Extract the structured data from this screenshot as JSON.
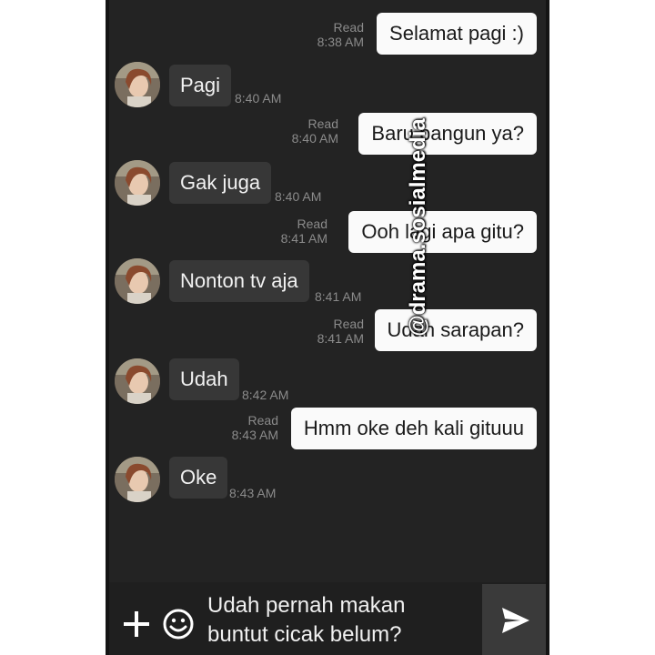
{
  "messages": [
    {
      "dir": "out",
      "text": "Selamat pagi :)",
      "status": "Read",
      "time": "8:38 AM"
    },
    {
      "dir": "in",
      "text": "Pagi",
      "time": "8:40 AM"
    },
    {
      "dir": "out",
      "text": "Baru bangun ya?",
      "status": "Read",
      "time": "8:40 AM"
    },
    {
      "dir": "in",
      "text": "Gak juga",
      "time": "8:40 AM"
    },
    {
      "dir": "out",
      "text": "Ooh lagi apa gitu?",
      "status": "Read",
      "time": "8:41 AM"
    },
    {
      "dir": "in",
      "text": "Nonton tv aja",
      "time": "8:41 AM"
    },
    {
      "dir": "out",
      "text": "Udah sarapan?",
      "status": "Read",
      "time": "8:41 AM"
    },
    {
      "dir": "in",
      "text": "Udah",
      "time": "8:42 AM"
    },
    {
      "dir": "out",
      "text": "Hmm oke deh kali gituuu",
      "status": "Read",
      "time": "8:43 AM"
    },
    {
      "dir": "in",
      "text": "Oke",
      "time": "8:43 AM"
    }
  ],
  "composer": {
    "text": "Udah pernah makan\nbuntut cicak belum?",
    "plus_icon": "plus-icon",
    "emoji_icon": "emoji-icon",
    "send_icon": "send-icon"
  },
  "watermark": "@drama.sosialmedia",
  "colors": {
    "background": "#232323",
    "outgoing_bubble": "#fafafa",
    "incoming_bubble": "#373737",
    "meta_text": "#8b8b8b"
  }
}
